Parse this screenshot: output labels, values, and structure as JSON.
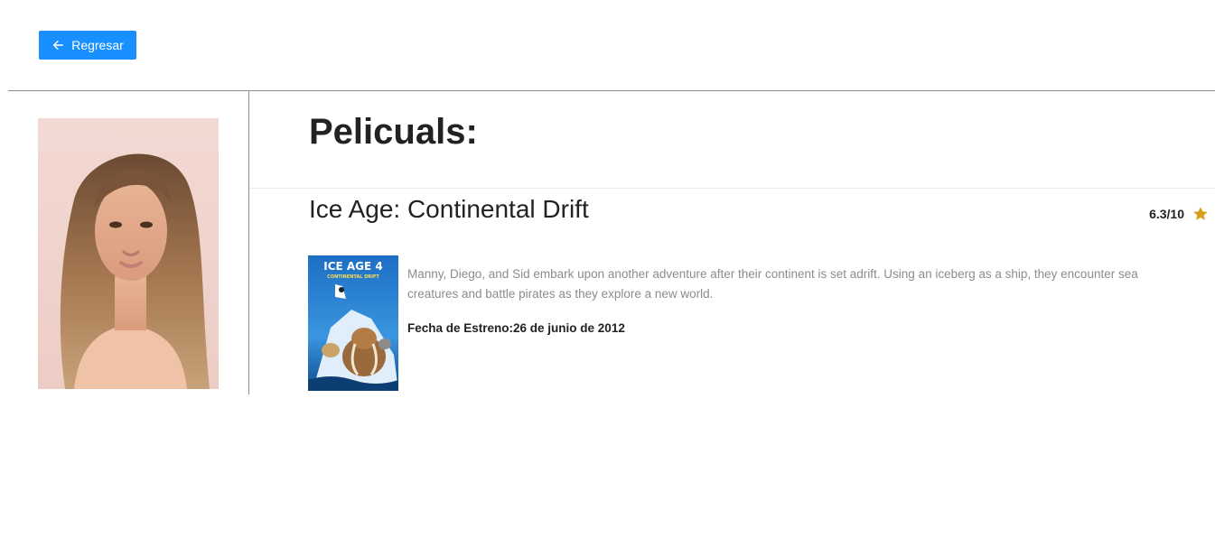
{
  "header": {
    "back_button_label": "Regresar",
    "back_icon": "arrow-left-icon",
    "accent_color": "#1890ff"
  },
  "actor": {
    "photo_icon": "actor-portrait"
  },
  "movies_section": {
    "title": "Pelicuals:"
  },
  "movie": {
    "title": "Ice Age: Continental Drift",
    "rating": "6.3/10",
    "rating_icon": "star-icon",
    "star_color": "#d4a017",
    "poster_text": "ICE AGE 4",
    "poster_subtitle": "CONTINENTAL DRIFT",
    "overview": "Manny, Diego, and Sid embark upon another adventure after their continent is set adrift. Using an iceberg as a ship, they encounter sea creatures and battle pirates as they explore a new world.",
    "release_label": "Fecha de Estreno:",
    "release_date": "26 de junio de 2012"
  }
}
